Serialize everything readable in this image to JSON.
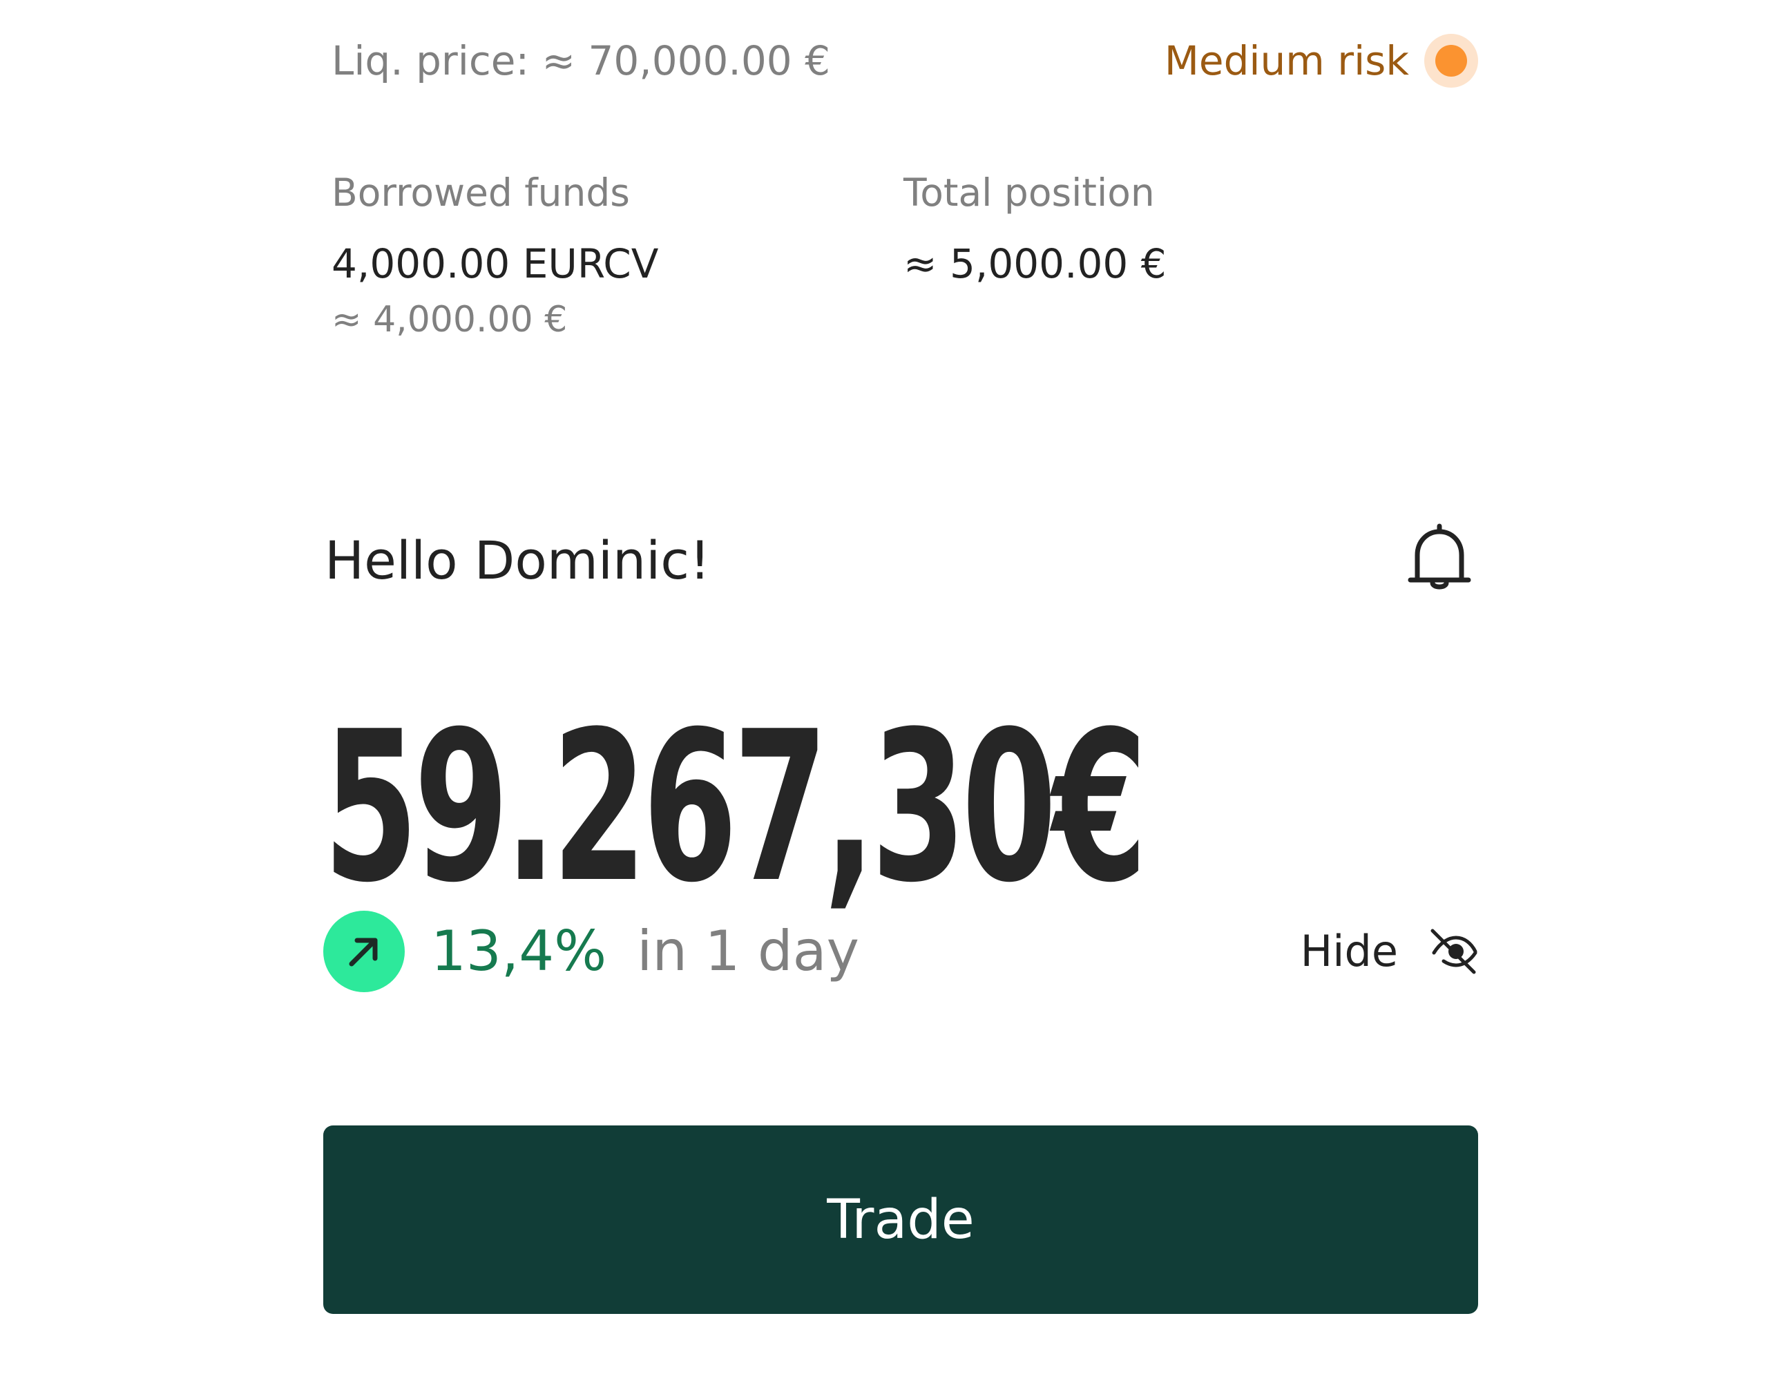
{
  "position": {
    "liq_price": "Liq. price: ≈ 70,000.00 €",
    "risk_label": "Medium risk",
    "borrowed_funds_label": "Borrowed funds",
    "borrowed_funds_value": "4,000.00  EURCV",
    "borrowed_funds_fiat": "≈ 4,000.00 €",
    "total_position_label": "Total position",
    "total_position_value": "≈ 5,000.00 €"
  },
  "header": {
    "greeting": "Hello Dominic!",
    "notifications_icon": "bell-icon"
  },
  "portfolio": {
    "balance": "59.267,30€",
    "change_icon": "arrow-up-right-icon",
    "change_percent": "13,4%",
    "change_period": "in 1 day",
    "hide_label": "Hide",
    "hide_icon": "eye-off-icon"
  },
  "actions": {
    "trade_label": "Trade"
  },
  "colors": {
    "risk_text": "#9b5a12",
    "risk_dot": "#fb9330",
    "positive": "#167a4f",
    "positive_badge": "#2de99b",
    "primary_button": "#113d37"
  }
}
